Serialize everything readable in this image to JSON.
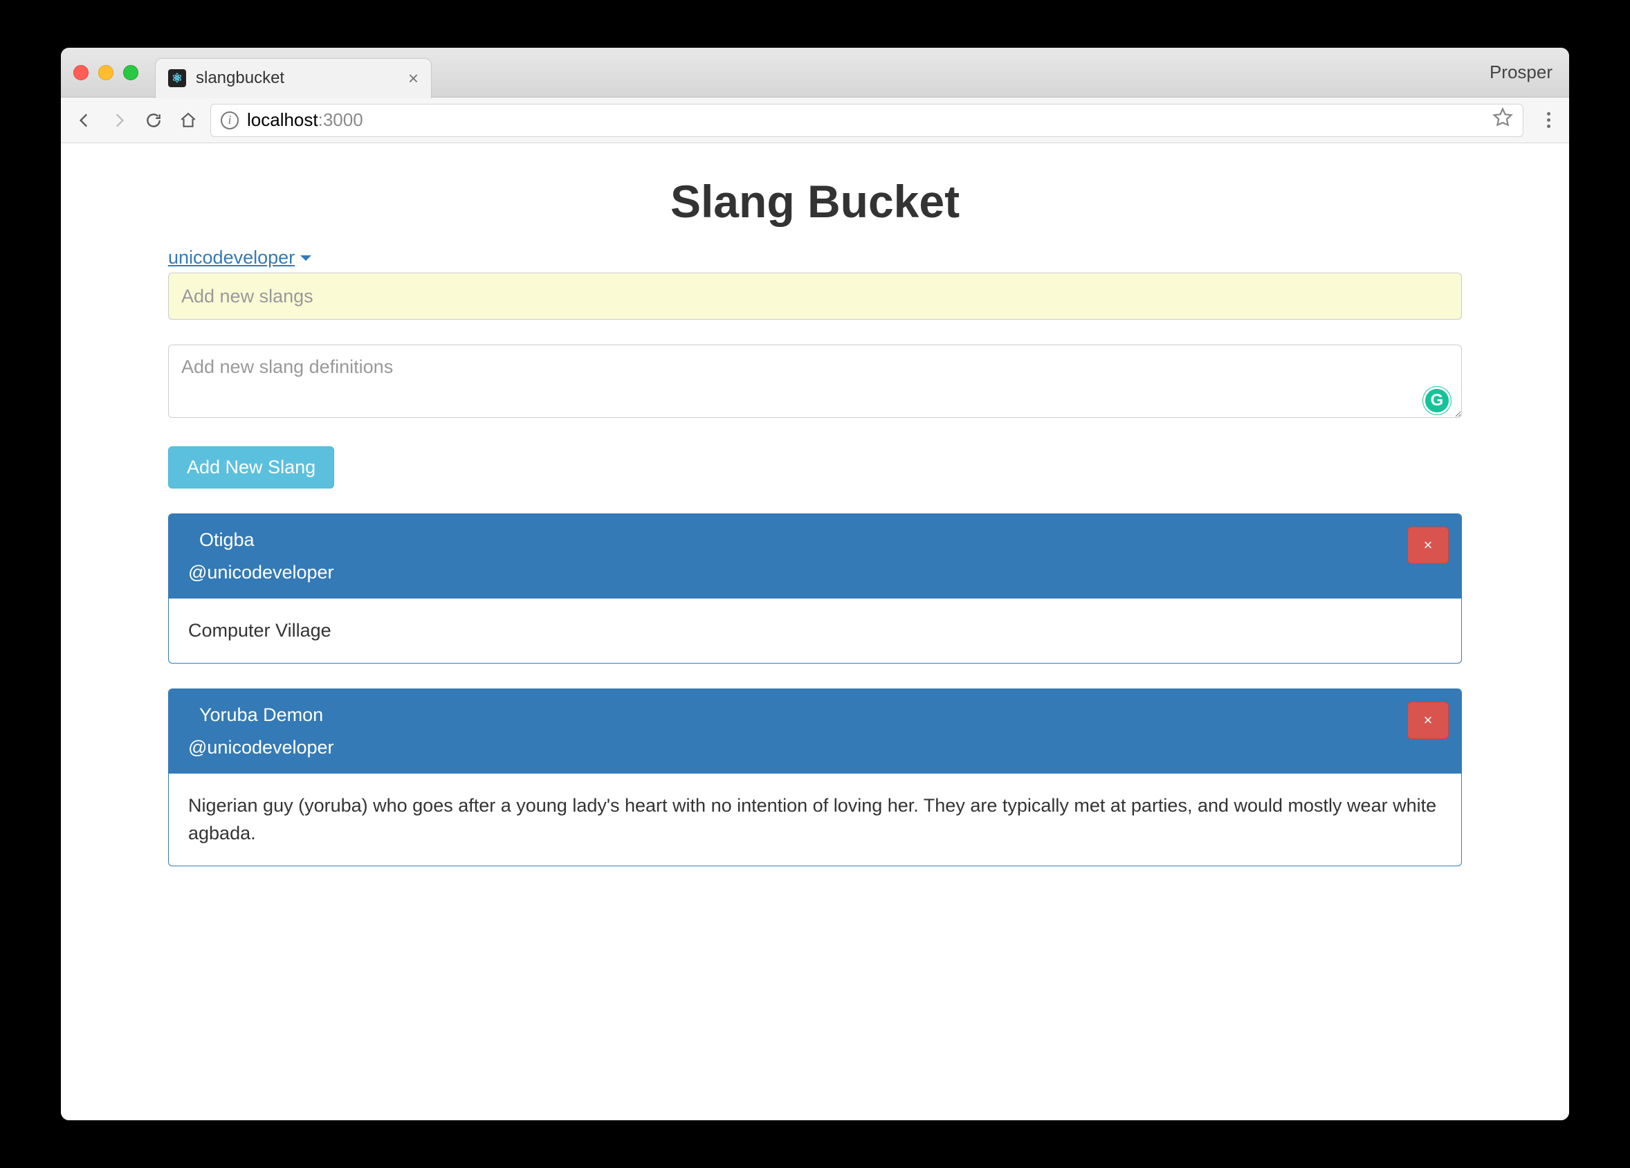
{
  "browser": {
    "tab_title": "slangbucket",
    "profile": "Prosper",
    "url_host": "localhost",
    "url_port": ":3000"
  },
  "page": {
    "title": "Slang Bucket",
    "user_link": "unicodeveloper",
    "input_slang_placeholder": "Add new slangs",
    "textarea_def_placeholder": "Add new slang definitions",
    "add_button_label": "Add New Slang"
  },
  "slangs": [
    {
      "title": "Otigba",
      "author": "@unicodeveloper",
      "definition": "Computer Village",
      "delete_label": "×"
    },
    {
      "title": "Yoruba Demon",
      "author": "@unicodeveloper",
      "definition": "Nigerian guy (yoruba) who goes after a young lady's heart with no intention of loving her. They are typically met at parties, and would mostly wear white agbada.",
      "delete_label": "×"
    }
  ]
}
